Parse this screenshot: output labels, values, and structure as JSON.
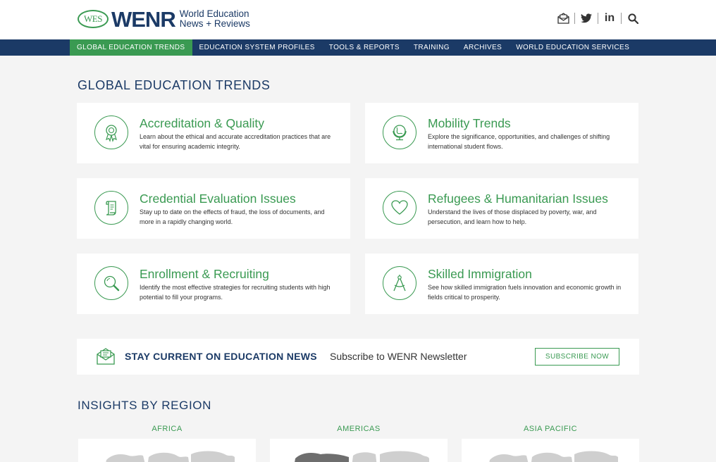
{
  "brand": {
    "wes": "WES",
    "wenr": "WENR",
    "tagline_line1": "World Education",
    "tagline_line2": "News + Reviews"
  },
  "header_icons": {
    "linkedin_text": "in"
  },
  "nav": {
    "items": [
      {
        "label": "GLOBAL EDUCATION TRENDS"
      },
      {
        "label": "EDUCATION SYSTEM PROFILES"
      },
      {
        "label": "TOOLS & REPORTS"
      },
      {
        "label": "TRAINING"
      },
      {
        "label": "ARCHIVES"
      },
      {
        "label": "WORLD EDUCATION SERVICES"
      }
    ]
  },
  "trends": {
    "title": "GLOBAL EDUCATION TRENDS",
    "cards": [
      {
        "title": "Accreditation & Quality",
        "desc": "Learn about the ethical and accurate accreditation practices that are vital for ensuring academic integrity.",
        "icon": "award-icon"
      },
      {
        "title": "Mobility Trends",
        "desc": "Explore the significance, opportunities, and challenges of shifting international student flows.",
        "icon": "globe-icon"
      },
      {
        "title": "Credential Evaluation Issues",
        "desc": "Stay up to date on the effects of fraud, the loss of documents, and more in a rapidly changing world.",
        "icon": "scroll-icon"
      },
      {
        "title": "Refugees & Humanitarian Issues",
        "desc": "Understand the lives of those displaced by poverty, war, and persecution, and learn how to help.",
        "icon": "heart-icon"
      },
      {
        "title": "Enrollment & Recruiting",
        "desc": "Identify the most effective strategies for recruiting students with high potential to fill your programs.",
        "icon": "magnifier-icon"
      },
      {
        "title": "Skilled Immigration",
        "desc": "See how skilled immigration fuels innovation and economic growth in fields critical to prosperity.",
        "icon": "compass-icon"
      }
    ]
  },
  "newsletter": {
    "heading": "STAY CURRENT ON EDUCATION NEWS",
    "sub": "Subscribe to WENR Newsletter",
    "button": "SUBSCRIBE NOW"
  },
  "regions": {
    "title": "INSIGHTS BY REGION",
    "items": [
      {
        "label": "AFRICA"
      },
      {
        "label": "AMERICAS"
      },
      {
        "label": "ASIA PACIFIC"
      }
    ]
  },
  "colors": {
    "navy": "#1b3a66",
    "green": "#3a9a52",
    "background": "#f4f4f4"
  }
}
